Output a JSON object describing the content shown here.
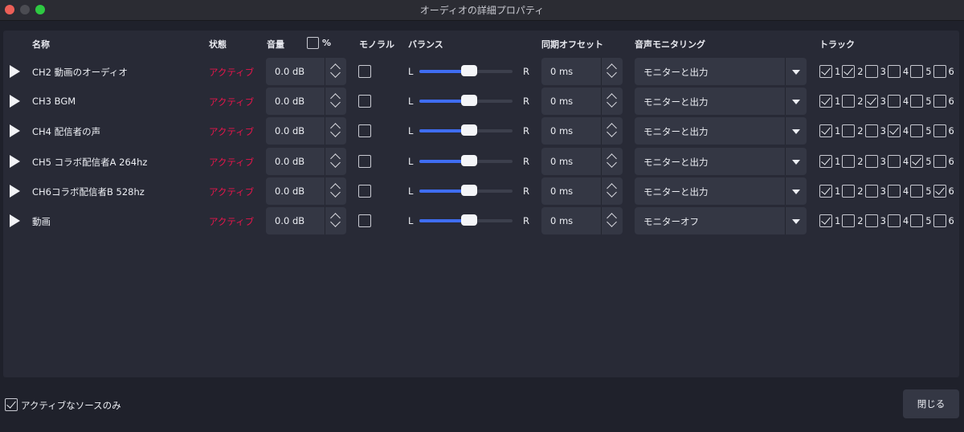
{
  "window": {
    "title": "オーディオの詳細プロパティ"
  },
  "headers": {
    "name": "名称",
    "status": "状態",
    "volume": "音量",
    "percent": "%",
    "mono": "モノラル",
    "balance": "バランス",
    "sync_offset": "同期オフセット",
    "monitoring": "音声モニタリング",
    "tracks": "トラック"
  },
  "sources": [
    {
      "name": "CH2 動画のオーディオ",
      "status": "アクティブ",
      "volume": "0.0 dB",
      "mono": false,
      "balance_left": "L",
      "balance_right": "R",
      "balance": 0.5,
      "offset": "0 ms",
      "monitoring": "モニターと出力",
      "tracks": [
        {
          "num": "1",
          "checked": true
        },
        {
          "num": "2",
          "checked": true
        },
        {
          "num": "3",
          "checked": false
        },
        {
          "num": "4",
          "checked": false
        },
        {
          "num": "5",
          "checked": false
        },
        {
          "num": "6",
          "checked": false
        }
      ]
    },
    {
      "name": "CH3 BGM",
      "status": "アクティブ",
      "volume": "0.0 dB",
      "mono": false,
      "balance_left": "L",
      "balance_right": "R",
      "balance": 0.5,
      "offset": "0 ms",
      "monitoring": "モニターと出力",
      "tracks": [
        {
          "num": "1",
          "checked": true
        },
        {
          "num": "2",
          "checked": false
        },
        {
          "num": "3",
          "checked": true
        },
        {
          "num": "4",
          "checked": false
        },
        {
          "num": "5",
          "checked": false
        },
        {
          "num": "6",
          "checked": false
        }
      ]
    },
    {
      "name": "CH4 配信者の声",
      "status": "アクティブ",
      "volume": "0.0 dB",
      "mono": false,
      "balance_left": "L",
      "balance_right": "R",
      "balance": 0.5,
      "offset": "0 ms",
      "monitoring": "モニターと出力",
      "tracks": [
        {
          "num": "1",
          "checked": true
        },
        {
          "num": "2",
          "checked": false
        },
        {
          "num": "3",
          "checked": false
        },
        {
          "num": "4",
          "checked": true
        },
        {
          "num": "5",
          "checked": false
        },
        {
          "num": "6",
          "checked": false
        }
      ]
    },
    {
      "name": "CH5 コラボ配信者A 264hz",
      "status": "アクティブ",
      "volume": "0.0 dB",
      "mono": false,
      "balance_left": "L",
      "balance_right": "R",
      "balance": 0.5,
      "offset": "0 ms",
      "monitoring": "モニターと出力",
      "tracks": [
        {
          "num": "1",
          "checked": true
        },
        {
          "num": "2",
          "checked": false
        },
        {
          "num": "3",
          "checked": false
        },
        {
          "num": "4",
          "checked": false
        },
        {
          "num": "5",
          "checked": true
        },
        {
          "num": "6",
          "checked": false
        }
      ]
    },
    {
      "name": "CH6コラボ配信者B 528hz",
      "status": "アクティブ",
      "volume": "0.0 dB",
      "mono": false,
      "balance_left": "L",
      "balance_right": "R",
      "balance": 0.5,
      "offset": "0 ms",
      "monitoring": "モニターと出力",
      "tracks": [
        {
          "num": "1",
          "checked": true
        },
        {
          "num": "2",
          "checked": false
        },
        {
          "num": "3",
          "checked": false
        },
        {
          "num": "4",
          "checked": false
        },
        {
          "num": "5",
          "checked": false
        },
        {
          "num": "6",
          "checked": true
        }
      ]
    },
    {
      "name": "動画",
      "status": "アクティブ",
      "volume": "0.0 dB",
      "mono": false,
      "balance_left": "L",
      "balance_right": "R",
      "balance": 0.5,
      "offset": "0 ms",
      "monitoring": "モニターオフ",
      "tracks": [
        {
          "num": "1",
          "checked": true
        },
        {
          "num": "2",
          "checked": false
        },
        {
          "num": "3",
          "checked": false
        },
        {
          "num": "4",
          "checked": false
        },
        {
          "num": "5",
          "checked": false
        },
        {
          "num": "6",
          "checked": false
        }
      ]
    }
  ],
  "footer": {
    "active_only_label": "アクティブなソースのみ",
    "active_only_checked": true,
    "close_label": "閉じる"
  },
  "colors": {
    "status_active": "#e8154b",
    "slider_fill": "#3f6df2",
    "background": "#1f212b",
    "panel": "#282a36"
  }
}
